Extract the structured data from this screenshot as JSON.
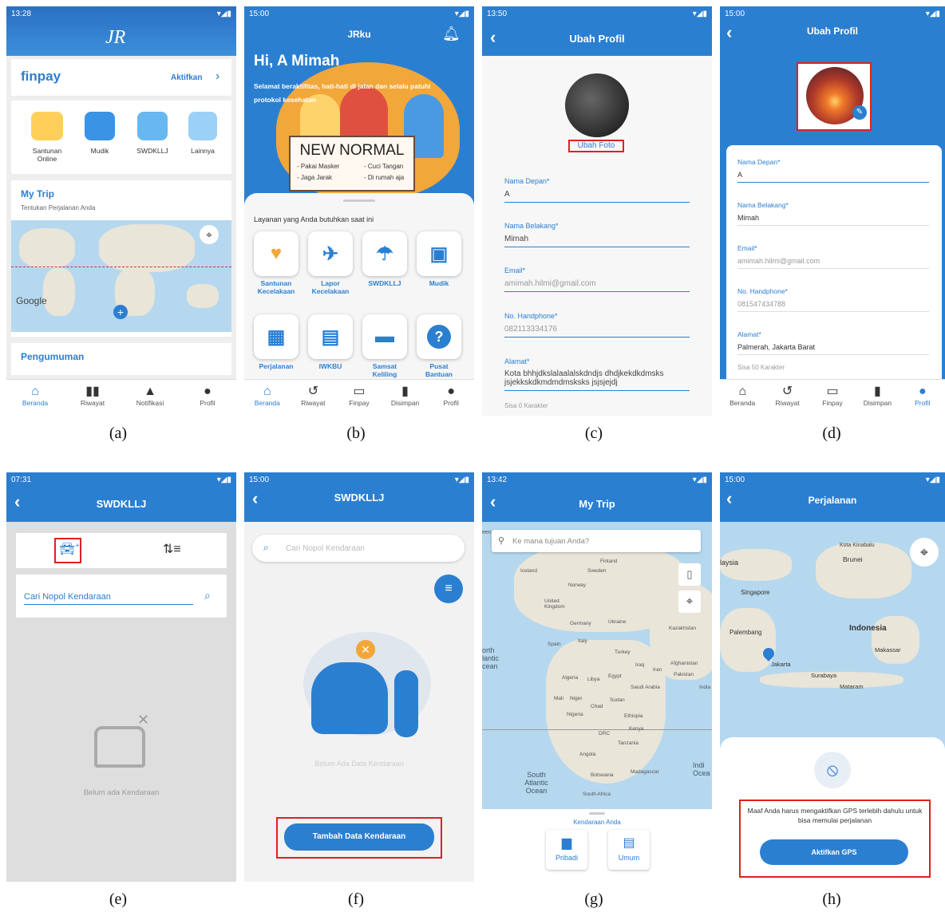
{
  "captions": [
    "(a)",
    "(b)",
    "(c)",
    "(d)",
    "(e)",
    "(f)",
    "(g)",
    "(h)"
  ],
  "a": {
    "time": "13:28",
    "logo": "JR",
    "finpay": {
      "brand": "finpay",
      "action": "Aktifkan"
    },
    "services": [
      "Santunan Online",
      "Mudik",
      "SWDKLLJ",
      "Lainnya"
    ],
    "mytrip": {
      "title": "My Trip",
      "subtitle": "Tentukan Perjalanan Anda",
      "google": "Google"
    },
    "announcement": "Pengumuman",
    "nav": [
      "Beranda",
      "Riwayat",
      "Notifikasi",
      "Profil"
    ]
  },
  "b": {
    "time": "15:00",
    "title": "JRku",
    "greeting": "Hi, A Mimah",
    "message": "Selamat beraktifitas, hati-hati di jalan dan selalu patuhi protokol kesehatan",
    "banner": {
      "title": "NEW NORMAL",
      "items": [
        "- Pakai Masker",
        "- Cuci Tangan",
        "- Jaga Jarak",
        "- Di rumah aja"
      ]
    },
    "section": "Layanan yang Anda butuhkan saat ini",
    "services": [
      "Santunan Kecelakaan",
      "Lapor Kecelakaan",
      "SWDKLLJ",
      "Mudik",
      "Perjalanan",
      "IWKBU",
      "Samsat Keliling",
      "Pusat Bantuan"
    ],
    "nav": [
      "Beranda",
      "Riwayat",
      "Finpay",
      "Disimpan",
      "Profil"
    ]
  },
  "c": {
    "time": "13:50",
    "title": "Ubah Profil",
    "photo_link": "Ubah Foto",
    "fields": [
      {
        "label": "Nama Depan*",
        "value": "A"
      },
      {
        "label": "Nama Belakang*",
        "value": "Mimah"
      },
      {
        "label": "Email*",
        "value": "amimah.hilmi@gmail.com"
      },
      {
        "label": "No. Handphone*",
        "value": "082113334176"
      },
      {
        "label": "Alamat*",
        "value": "Kota bhhjdkslalaalalskdndjs dhdjkekdkdmsks jsjekkskdkmdmdmsksks jsjsjejdj"
      }
    ],
    "counter": "Sisa 0 Karakter"
  },
  "d": {
    "time": "15:00",
    "title": "Ubah Profil",
    "fields": [
      {
        "label": "Nama Depan*",
        "value": "A"
      },
      {
        "label": "Nama Belakang*",
        "value": "Mimah"
      },
      {
        "label": "Email*",
        "value": "amimah.hilmi@gmail.com"
      },
      {
        "label": "No. Handphone*",
        "value": "081547434788"
      },
      {
        "label": "Alamat*",
        "value": "Palmerah, Jakarta Barat"
      }
    ],
    "counter": "Sisa 50 Karakter",
    "nav": [
      "Beranda",
      "Riwayat",
      "Finpay",
      "Disimpan",
      "Profil"
    ]
  },
  "e": {
    "time": "07:31",
    "title": "SWDKLLJ",
    "search_placeholder": "Cari Nopol Kendaraan",
    "empty": "Belum ada Kendaraan"
  },
  "f": {
    "time": "15:00",
    "title": "SWDKLLJ",
    "search_placeholder": "Cari Nopol Kendaraan",
    "empty": "Belum Ada Data Kendaraan",
    "button": "Tambah Data Kendaraan"
  },
  "g": {
    "time": "13:42",
    "title": "My Trip",
    "search_placeholder": "Ke mana tujuan Anda?",
    "map_labels": [
      "Finland",
      "Sweden",
      "Iceland",
      "Norway",
      "United Kingdom",
      "Germany",
      "Ukraine",
      "Kazakhstan",
      "Spain",
      "Italy",
      "Turkey",
      "Iraq",
      "Iran",
      "Afghanistan",
      "Pakistan",
      "Algeria",
      "Libya",
      "Egypt",
      "Saudi Arabia",
      "India",
      "Mali",
      "Niger",
      "Chad",
      "Sudan",
      "Nigeria",
      "Ethiopia",
      "DRC",
      "Kenya",
      "Tanzania",
      "Angola",
      "Botswana",
      "Madagascar",
      "South Africa",
      "South Atlantic Ocean",
      "orth lantic cean",
      "Indi Ocea",
      "een"
    ],
    "vehicle_label": "Kendaraan Anda",
    "vehicles": [
      "Pribadi",
      "Umum"
    ]
  },
  "h": {
    "time": "15:00",
    "title": "Perjalanan",
    "map_labels": [
      "Kota Kinabalu",
      "laysia",
      "Brunei",
      "Singapore",
      "Indonesia",
      "Palembang",
      "Makassar",
      "Jakarta",
      "Surabaya",
      "Mataram"
    ],
    "message": "Maaf Anda harus mengaktifkan GPS terlebih dahulu untuk bisa memulai perjalanan",
    "button": "Aktifkan GPS"
  },
  "colors": {
    "primary": "#2b7fd1",
    "highlight": "#e02020",
    "bg_grey": "#efefef"
  }
}
